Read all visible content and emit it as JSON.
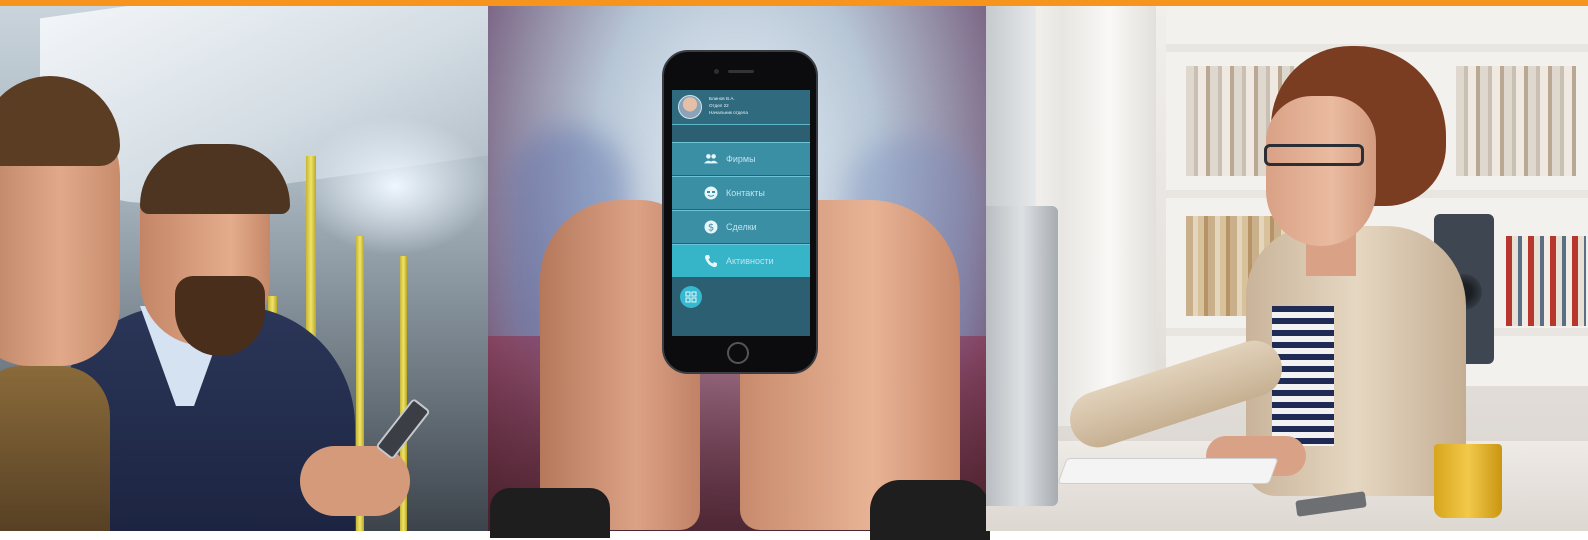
{
  "colors": {
    "accent_bar": "#f7941d",
    "screen_bg": "#2d5f72",
    "menu_item": "#3a8fa5",
    "menu_item_active": "#36b5c9",
    "menu_text": "#bfe3ee"
  },
  "app": {
    "user": {
      "name": "Блинов В.А.",
      "department": "Отдел 22",
      "position": "Начальник отдела"
    },
    "menu": [
      {
        "label": "Фирмы",
        "icon": "people-icon",
        "active": false
      },
      {
        "label": "Контакты",
        "icon": "contact-face-icon",
        "active": false
      },
      {
        "label": "Сделки",
        "icon": "dollar-icon",
        "active": false
      },
      {
        "label": "Активности",
        "icon": "phone-icon",
        "active": true
      }
    ],
    "fab_icon": "grid-icon"
  }
}
